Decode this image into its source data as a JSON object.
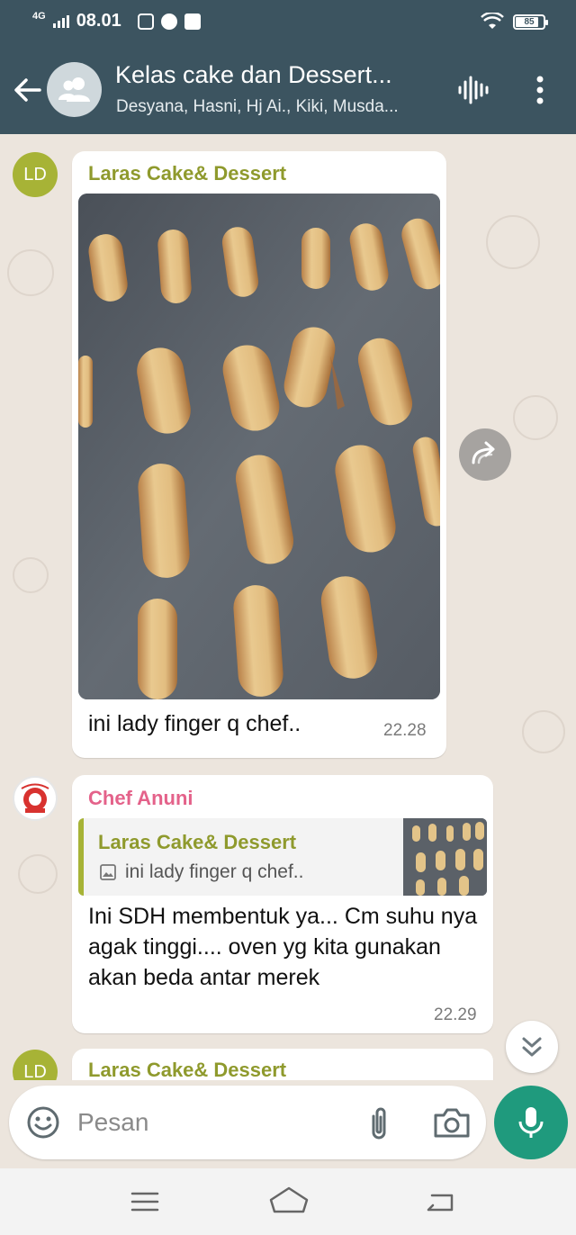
{
  "status_bar": {
    "network": "4G",
    "time": "08.01",
    "battery": "85",
    "battery_level": 0.85
  },
  "header": {
    "title": "Kelas cake dan Dessert...",
    "subtitle": "Desyana, Hasni, Hj Ai., Kiki, Musda..."
  },
  "messages": [
    {
      "sender": "Laras Cake& Dessert",
      "avatar_initials": "LD",
      "text": "ini lady finger q chef..",
      "time": "22.28",
      "sender_color": "#8f9a2d"
    },
    {
      "sender": "Chef Anuni",
      "quote": {
        "sender": "Laras Cake& Dessert",
        "text": "ini lady finger q chef.."
      },
      "text": "Ini SDH membentuk ya... Cm suhu nya agak tinggi.... oven yg kita gunakan akan beda antar merek",
      "time": "22.29",
      "sender_color": "#e4628a"
    },
    {
      "sender": "Laras Cake& Dessert",
      "avatar_initials": "LD",
      "sender_color": "#8f9a2d"
    }
  ],
  "composer": {
    "placeholder": "Pesan"
  },
  "colors": {
    "header_bg": "#3c5460",
    "accent_green": "#1f9a7d",
    "chat_bg": "#ece5dd"
  }
}
